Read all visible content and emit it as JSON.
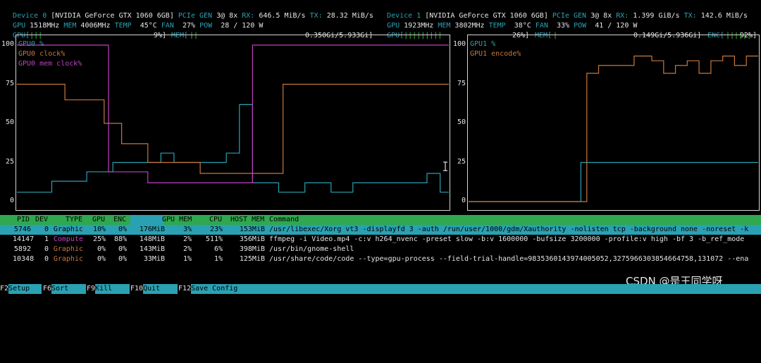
{
  "devices": [
    {
      "line1": {
        "device": "Device 0",
        "name": "[NVIDIA GeForce GTX 1060 6GB]",
        "pcie": "PCIe",
        "gen": "GEN",
        "gen_val": "3@ 8x",
        "rx": "RX:",
        "rx_val": "646.5 MiB/s",
        "tx": "TX:",
        "tx_val": "28.32 MiB/s"
      },
      "line2": {
        "gpu": "GPU",
        "gpu_clk": "1518MHz",
        "mem": "MEM",
        "mem_clk": "4006MHz",
        "temp": "TEMP",
        "temp_val": "45°C",
        "fan": "FAN",
        "fan_val": "27%",
        "pow": "POW",
        "pow_val": "28 / 120 W"
      },
      "line3": {
        "gpu": "GPU[",
        "gpu_bar": "|||",
        "gpu_pct": "9%]",
        "mem": "MEM[",
        "mem_bar": "||",
        "mem_val": "0.350Gi/5.933Gi]"
      }
    },
    {
      "line1": {
        "device": "Device 1",
        "name": "[NVIDIA GeForce GTX 1060 6GB]",
        "pcie": "PCIe",
        "gen": "GEN",
        "gen_val": "3@ 8x",
        "rx": "RX:",
        "rx_val": "1.399 GiB/s",
        "tx": "TX:",
        "tx_val": "142.6 MiB/s"
      },
      "line2": {
        "gpu": "GPU",
        "gpu_clk": "1923MHz",
        "mem": "MEM",
        "mem_clk": "3802MHz",
        "temp": "TEMP",
        "temp_val": "38°C",
        "fan": "FAN",
        "fan_val": "33%",
        "pow": "POW",
        "pow_val": "41 / 120 W"
      },
      "line3": {
        "gpu": "GPU[",
        "gpu_bar": "|||||||||",
        "gpu_pct": "26%]",
        "mem": "MEM[",
        "mem_bar": "|",
        "mem_val": "0.149Gi/5.936Gi]",
        "enc": "ENC[",
        "enc_bar": "||||||",
        "enc_pct": "92%]"
      }
    }
  ],
  "chart_data": [
    {
      "type": "line",
      "ylim": [
        0,
        100
      ],
      "yticks": [
        "100",
        "75",
        "50",
        "25",
        "0"
      ],
      "legend_placement": "top-left",
      "x": [
        0,
        1,
        2,
        3,
        4,
        5,
        6,
        7,
        8,
        9,
        10,
        11,
        12,
        13,
        14,
        15,
        16,
        17,
        18,
        19,
        20,
        21,
        22,
        23,
        24,
        25,
        26,
        27,
        28,
        29,
        30,
        31,
        32,
        33,
        34,
        35,
        36,
        37,
        38,
        39,
        40,
        41,
        42,
        43,
        44,
        45,
        46,
        47,
        48,
        49,
        50,
        51,
        52,
        53,
        54,
        55,
        56,
        57,
        58,
        59,
        60,
        61,
        62,
        63,
        64,
        65,
        66,
        67,
        68,
        69,
        70,
        71,
        72,
        73,
        74,
        75,
        76,
        77,
        78,
        79,
        80,
        81,
        82,
        83,
        84,
        85,
        86,
        87,
        88,
        89,
        90,
        91,
        92,
        93,
        94,
        95,
        96,
        97,
        98,
        99
      ],
      "series": [
        {
          "name": "GPU0 %",
          "color": "#2aa1b3",
          "values": [
            6,
            6,
            6,
            6,
            6,
            6,
            6,
            6,
            13,
            13,
            13,
            13,
            13,
            13,
            13,
            13,
            19,
            19,
            19,
            19,
            19,
            19,
            25,
            25,
            25,
            25,
            25,
            25,
            25,
            25,
            25,
            25,
            25,
            31,
            31,
            31,
            25,
            25,
            25,
            25,
            25,
            25,
            25,
            25,
            25,
            25,
            25,
            25,
            31,
            31,
            31,
            62,
            62,
            62,
            12,
            12,
            12,
            12,
            12,
            12,
            6,
            6,
            6,
            6,
            6,
            6,
            12,
            12,
            12,
            12,
            12,
            12,
            6,
            6,
            6,
            6,
            6,
            12,
            12,
            12,
            12,
            12,
            12,
            12,
            12,
            12,
            12,
            12,
            12,
            12,
            12,
            12,
            12,
            12,
            18,
            18,
            18,
            6,
            6,
            6
          ]
        },
        {
          "name": "GPU0 clock%",
          "color": "#c8783c",
          "values": [
            75,
            75,
            75,
            75,
            75,
            75,
            75,
            75,
            75,
            75,
            75,
            65,
            65,
            65,
            65,
            65,
            65,
            65,
            65,
            65,
            50,
            50,
            50,
            50,
            37,
            37,
            37,
            37,
            37,
            37,
            25,
            25,
            25,
            25,
            25,
            25,
            25,
            25,
            25,
            25,
            25,
            25,
            18,
            18,
            18,
            18,
            18,
            18,
            18,
            18,
            18,
            18,
            18,
            18,
            18,
            18,
            18,
            18,
            18,
            18,
            18,
            75,
            75,
            75,
            75,
            75,
            75,
            75,
            75,
            75,
            75,
            75,
            75,
            75,
            75,
            75,
            75,
            75,
            75,
            75,
            75,
            75,
            75,
            75,
            75,
            75,
            75,
            75,
            75,
            75,
            75,
            75,
            75,
            75,
            75,
            75,
            75,
            75,
            75,
            75
          ]
        },
        {
          "name": "GPU0 mem clock%",
          "color": "#c040c0",
          "values": [
            100,
            100,
            100,
            100,
            100,
            100,
            100,
            100,
            100,
            100,
            100,
            100,
            100,
            100,
            100,
            100,
            100,
            100,
            100,
            100,
            100,
            19,
            19,
            19,
            19,
            19,
            19,
            19,
            19,
            19,
            12,
            12,
            12,
            12,
            12,
            12,
            12,
            12,
            12,
            12,
            12,
            12,
            12,
            12,
            12,
            12,
            12,
            12,
            12,
            12,
            12,
            12,
            12,
            12,
            100,
            100,
            100,
            100,
            100,
            100,
            100,
            100,
            100,
            100,
            100,
            100,
            100,
            100,
            100,
            100,
            100,
            100,
            100,
            100,
            100,
            100,
            100,
            100,
            100,
            100,
            100,
            100,
            100,
            100,
            100,
            100,
            100,
            100,
            100,
            100,
            100,
            100,
            100,
            100,
            100,
            100,
            100,
            100,
            100,
            100
          ]
        }
      ]
    },
    {
      "type": "line",
      "ylim": [
        0,
        100
      ],
      "yticks": [
        "100",
        "75",
        "50",
        "25",
        "0"
      ],
      "legend_placement": "top-left",
      "x": [
        0,
        1,
        2,
        3,
        4,
        5,
        6,
        7,
        8,
        9,
        10,
        11,
        12,
        13,
        14,
        15,
        16,
        17,
        18,
        19,
        20,
        21,
        22,
        23,
        24,
        25,
        26,
        27,
        28,
        29,
        30,
        31,
        32,
        33,
        34,
        35,
        36,
        37,
        38,
        39,
        40,
        41,
        42,
        43,
        44,
        45,
        46,
        47,
        48,
        49
      ],
      "series": [
        {
          "name": "GPU1 %",
          "color": "#2aa1b3",
          "values": [
            0,
            0,
            0,
            0,
            0,
            0,
            0,
            0,
            0,
            0,
            0,
            0,
            0,
            0,
            0,
            0,
            0,
            0,
            0,
            25,
            25,
            25,
            25,
            25,
            25,
            25,
            25,
            25,
            25,
            25,
            25,
            25,
            25,
            25,
            25,
            25,
            25,
            25,
            25,
            25,
            25,
            25,
            25,
            25,
            25,
            25,
            25,
            25,
            25,
            25
          ]
        },
        {
          "name": "GPU1 encode%",
          "color": "#c8783c",
          "values": [
            0,
            0,
            0,
            0,
            0,
            0,
            0,
            0,
            0,
            0,
            0,
            0,
            0,
            0,
            0,
            0,
            0,
            0,
            0,
            0,
            82,
            82,
            87,
            87,
            87,
            87,
            87,
            87,
            93,
            93,
            93,
            90,
            90,
            82,
            82,
            87,
            87,
            90,
            90,
            82,
            82,
            90,
            90,
            93,
            93,
            87,
            87,
            93,
            93,
            93
          ]
        }
      ]
    }
  ],
  "process_table": {
    "headers": {
      "pid": "PID",
      "dev": "DEV",
      "type": "TYPE",
      "gpu": "GPU",
      "enc": "ENC",
      "gpu_mem": "GPU MEM",
      "cpu": "CPU",
      "host_mem": "HOST MEM",
      "command": "Command"
    },
    "rows": [
      {
        "pid": "5746",
        "dev": "0",
        "type": "Graphic",
        "gpu": "10%",
        "enc": "0%",
        "mem": "176MiB",
        "memp": "3%",
        "cpu": "23%",
        "host": "153MiB",
        "cmd": "/usr/libexec/Xorg vt3 -displayfd 3 -auth /run/user/1000/gdm/Xauthority -nolisten tcp -background none -noreset -k",
        "selected": true
      },
      {
        "pid": "14147",
        "dev": "1",
        "type": "Compute",
        "gpu": "25%",
        "enc": "88%",
        "mem": "148MiB",
        "memp": "2%",
        "cpu": "511%",
        "host": "356MiB",
        "cmd": "ffmpeg -i Video.mp4 -c:v h264_nvenc -preset slow -b:v 1600000 -bufsize 3200000 -profile:v high -bf 3 -b_ref_mode"
      },
      {
        "pid": "5892",
        "dev": "0",
        "type": "Graphic",
        "gpu": "0%",
        "enc": "0%",
        "mem": "143MiB",
        "memp": "2%",
        "cpu": "6%",
        "host": "398MiB",
        "cmd": "/usr/bin/gnome-shell"
      },
      {
        "pid": "10348",
        "dev": "0",
        "type": "Graphic",
        "gpu": "0%",
        "enc": "0%",
        "mem": "33MiB",
        "memp": "1%",
        "cpu": "1%",
        "host": "125MiB",
        "cmd": "/usr/share/code/code --type=gpu-process --field-trial-handle=9835360143974005052,3275966303854664758,131072 --ena"
      }
    ]
  },
  "footer": {
    "keys": [
      {
        "key": "F2",
        "label": "Setup"
      },
      {
        "key": "F6",
        "label": "Sort"
      },
      {
        "key": "F9",
        "label": "Kill"
      },
      {
        "key": "F10",
        "label": "Quit"
      },
      {
        "key": "F12",
        "label": "Save Config"
      }
    ]
  },
  "watermark": "CSDN @是王同学呀",
  "colors": {
    "accent": "#2aa1b3",
    "orange": "#c8783c",
    "magenta": "#c040c0",
    "header_green": "#2fa84f"
  }
}
